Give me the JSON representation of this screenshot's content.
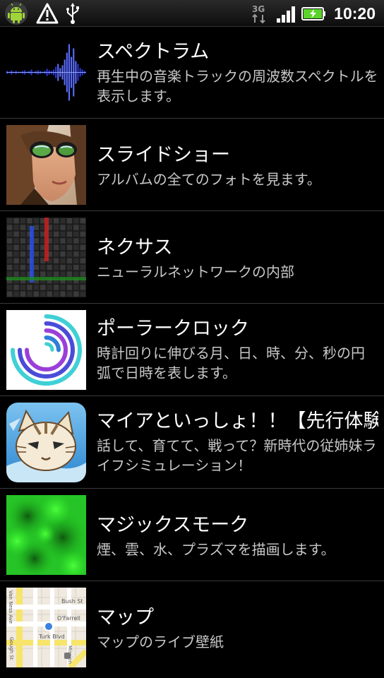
{
  "status_bar": {
    "time": "10:20",
    "network_label": "3G",
    "icons": [
      "android-icon",
      "warning-icon",
      "usb-icon",
      "3g-data-icon",
      "signal-strength-icon",
      "battery-charging-icon"
    ]
  },
  "colors": {
    "background": "#000000",
    "title_text": "#ffffff",
    "description_text": "#c8c8c8",
    "divider": "#3a3a3a",
    "battery_green": "#5bd42a"
  },
  "wallpapers": [
    {
      "title": "スペクトラム",
      "description": "再生中の音楽トラックの周波数スペクトルを表示します。",
      "thumbnail": "spectrum-thumbnail"
    },
    {
      "title": "スライドショー",
      "description": "アルバムの全てのフォトを見ます。",
      "thumbnail": "slideshow-thumbnail"
    },
    {
      "title": "ネクサス",
      "description": "ニューラルネットワークの内部",
      "thumbnail": "nexus-thumbnail"
    },
    {
      "title": "ポーラークロック",
      "description": "時計回りに伸びる月、日、時、分、秒の円弧で日時を表します。",
      "thumbnail": "polar-clock-thumbnail"
    },
    {
      "title": "マイアといっしょ！！【先行体験",
      "description": "話して、育てて、戦って？新時代の従姉妹ライフシミュレーション！",
      "thumbnail": "maia-thumbnail"
    },
    {
      "title": "マジックスモーク",
      "description": "煙、雲、水、プラズマを描画します。",
      "thumbnail": "magic-smoke-thumbnail"
    },
    {
      "title": "マップ",
      "description": "マップのライブ壁紙",
      "thumbnail": "map-thumbnail",
      "map_labels": [
        "Van Ness Ave",
        "Bush St",
        "O'Farrell",
        "Turk Blvd",
        "Gough St",
        "Mission"
      ]
    }
  ]
}
